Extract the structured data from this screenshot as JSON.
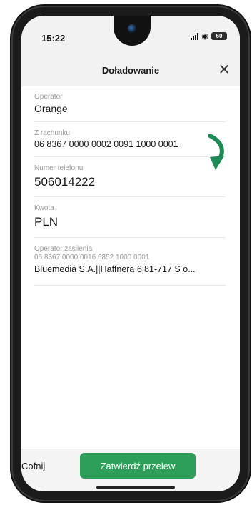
{
  "status": {
    "time": "15:22",
    "battery": "60"
  },
  "header": {
    "title": "Doładowanie",
    "close": "✕"
  },
  "fields": {
    "operator": {
      "label": "Operator",
      "value": "Orange"
    },
    "account": {
      "label": "Z rachunku",
      "value": "06 8367 0000 0002 0091 1000 0001"
    },
    "phone": {
      "label": "Numer telefonu",
      "value": "506014222"
    },
    "amount": {
      "label": "Kwota",
      "value": "PLN"
    },
    "top_up_operator": {
      "label": "Operator zasilenia",
      "account": "06 8367 0000 0016 6852 1000 0001",
      "value": "Bluemedia S.A.||Haffnera 6|81-717 S o..."
    }
  },
  "footer": {
    "back_label": "Cofnij",
    "confirm_label": "Zatwierdź przelew"
  },
  "colors": {
    "accent": "#2e9e5b",
    "arrow": "#1e8a55"
  },
  "icons": [
    "camera-icon",
    "signal-icon",
    "wifi-icon",
    "battery-icon",
    "close-icon",
    "curved-arrow-icon"
  ]
}
